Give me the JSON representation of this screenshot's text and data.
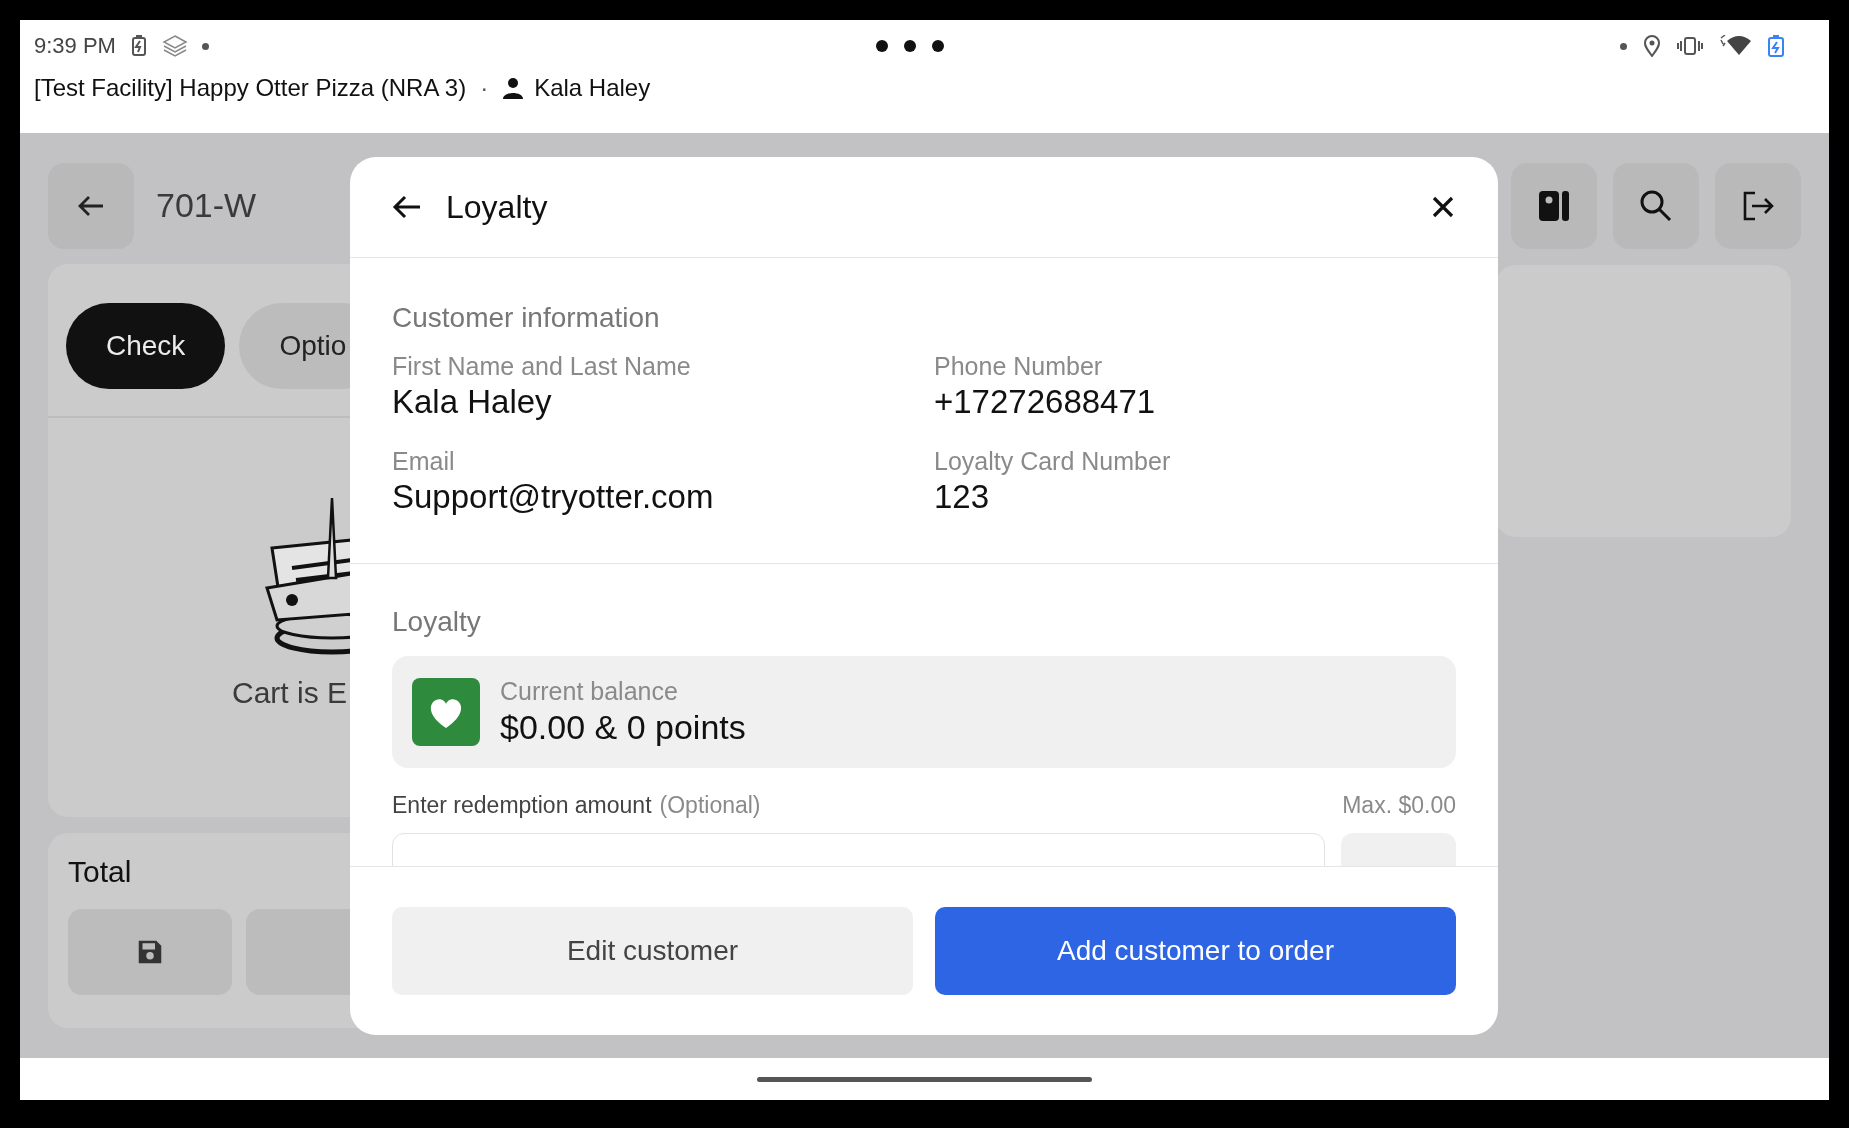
{
  "status_bar": {
    "time": "9:39 PM"
  },
  "header": {
    "facility": "[Test Facility] Happy Otter Pizza (NRA 3)",
    "separator": "·",
    "user": "Kala Haley"
  },
  "background": {
    "order_number": "701-W",
    "tabs": [
      {
        "label": "Check",
        "selected": true
      },
      {
        "label": "Optio",
        "selected": false
      }
    ],
    "empty_message": "Cart is E",
    "total_label": "Total"
  },
  "dialog": {
    "title": "Loyalty",
    "section_title": "Customer information",
    "fields": [
      {
        "label": "First Name and Last Name",
        "value": "Kala Haley"
      },
      {
        "label": "Phone Number",
        "value": "+17272688471"
      },
      {
        "label": "Email",
        "value": "Support@tryotter.com"
      },
      {
        "label": "Loyalty Card Number",
        "value": "123"
      }
    ],
    "loyalty_title": "Loyalty",
    "balance_label": "Current balance",
    "balance": "$0.00 & 0 points",
    "redemption_label": "Enter redemption amount",
    "redemption_hint": "(Optional)",
    "max": "Max. $0.00",
    "buttons": [
      {
        "label": "Edit customer",
        "kind": "secondary"
      },
      {
        "label": "Add customer to order",
        "kind": "primary"
      }
    ]
  }
}
